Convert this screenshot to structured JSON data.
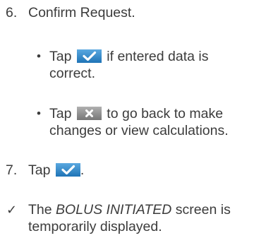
{
  "step6": {
    "number": "6.",
    "text": "Confirm Request."
  },
  "bullet1": {
    "marker": "•",
    "prefix": "Tap",
    "icon": "check-button-icon",
    "suffix": "if entered data is",
    "line2": "correct."
  },
  "bullet2": {
    "marker": "•",
    "prefix": "Tap",
    "icon": "cancel-x-button-icon",
    "suffix": "to go back to make",
    "line2": "changes or view calculations."
  },
  "step7": {
    "number": "7.",
    "prefix": "Tap",
    "icon": "check-button-icon",
    "suffix": "."
  },
  "result": {
    "marker": "✓",
    "prefix": "The",
    "emphasis": "BOLUS INITIATED",
    "suffix": "screen is",
    "line2": "temporarily displayed."
  },
  "colors": {
    "text": "#3c3c3c",
    "check_button": "#2f86c8",
    "x_button": "#8c8c8c"
  }
}
